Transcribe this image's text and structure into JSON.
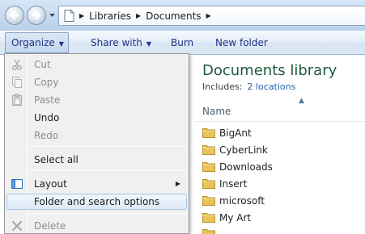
{
  "address_bar": {
    "crumbs": [
      "Libraries",
      "Documents"
    ]
  },
  "command_bar": {
    "organize": "Organize",
    "share_with": "Share with",
    "burn": "Burn",
    "new_folder": "New folder"
  },
  "library": {
    "title": "Documents library",
    "includes_label": "Includes:",
    "locations_link": "2 locations"
  },
  "columns": {
    "name": "Name"
  },
  "files": [
    {
      "name": "BigAnt"
    },
    {
      "name": "CyberLink"
    },
    {
      "name": "Downloads"
    },
    {
      "name": "Insert"
    },
    {
      "name": "microsoft"
    },
    {
      "name": "My Art"
    }
  ],
  "organize_menu": {
    "items": [
      {
        "label": "Cut",
        "enabled": false,
        "icon": "scissors-icon"
      },
      {
        "label": "Copy",
        "enabled": false,
        "icon": "copy-icon"
      },
      {
        "label": "Paste",
        "enabled": false,
        "icon": "paste-icon"
      },
      {
        "label": "Undo",
        "enabled": true
      },
      {
        "label": "Redo",
        "enabled": false
      },
      {
        "label": "Select all",
        "enabled": true
      },
      {
        "label": "Layout",
        "enabled": true,
        "icon": "layout-icon",
        "submenu": true
      },
      {
        "label": "Folder and search options",
        "enabled": true,
        "highlighted": true
      },
      {
        "label": "Delete",
        "enabled": false,
        "icon": "delete-icon"
      }
    ]
  },
  "colors": {
    "library_title": "#1e5a3c",
    "link": "#1c5fb0",
    "command_text": "#1e3287",
    "menu_background": "#f0f0f0",
    "menu_highlight_border": "#a8c3e5",
    "folder_yellow": "#e8c35a"
  }
}
